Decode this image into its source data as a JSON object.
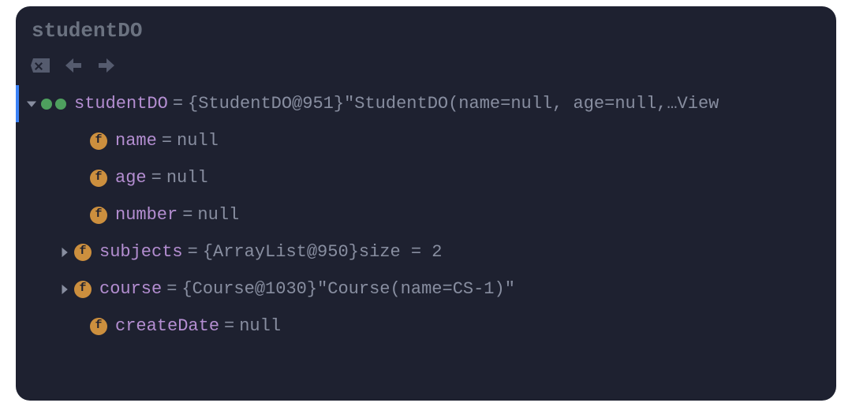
{
  "panel": {
    "title": "studentDO"
  },
  "root": {
    "name": "studentDO",
    "equals": " = ",
    "type": "{StudentDO@951}",
    "value": " \"StudentDO(name=null, age=null,… ",
    "viewLink": "View"
  },
  "fields": [
    {
      "badge": "f",
      "name": "name",
      "equals": " = ",
      "value": "null",
      "expandable": false
    },
    {
      "badge": "f",
      "name": "age",
      "equals": " = ",
      "value": "null",
      "expandable": false
    },
    {
      "badge": "f",
      "name": "number",
      "equals": " = ",
      "value": "null",
      "expandable": false
    },
    {
      "badge": "f",
      "name": "subjects",
      "equals": " = ",
      "type": "{ArrayList@950}",
      "size": "  size = 2",
      "expandable": true
    },
    {
      "badge": "f",
      "name": "course",
      "equals": " = ",
      "type": "{Course@1030}",
      "quoted": " \"Course(name=CS-1)\"",
      "expandable": true
    },
    {
      "badge": "f",
      "name": "createDate",
      "equals": " = ",
      "value": "null",
      "expandable": false
    }
  ]
}
